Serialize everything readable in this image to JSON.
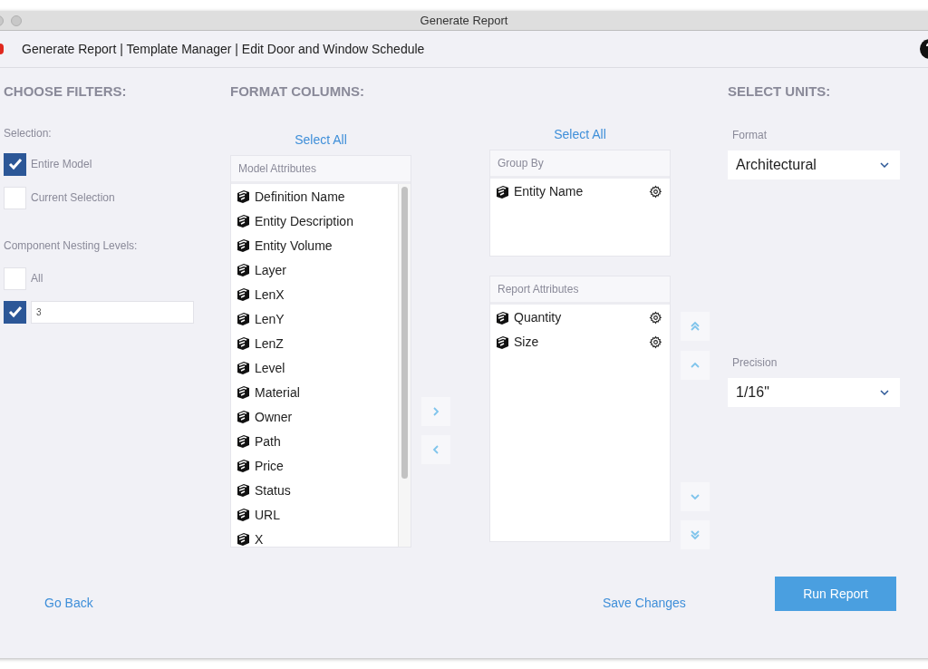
{
  "window": {
    "title": "Generate Report"
  },
  "breadcrumb": "Generate Report | Template Manager | Edit Door and Window Schedule",
  "filters": {
    "heading": "CHOOSE FILTERS:",
    "selection_label": "Selection:",
    "selection_options": [
      {
        "label": "Entire Model",
        "checked": true
      },
      {
        "label": "Current Selection",
        "checked": false
      }
    ],
    "nesting_label": "Component Nesting Levels:",
    "nesting_options": [
      {
        "kind": "checkbox",
        "label": "All",
        "checked": false
      },
      {
        "kind": "field",
        "value": "3",
        "checked": true
      }
    ]
  },
  "columns": {
    "heading": "FORMAT COLUMNS:",
    "model": {
      "select_all": "Select All",
      "title": "Model Attributes",
      "items": [
        "Definition Name",
        "Entity Description",
        "Entity Volume",
        "Layer",
        "LenX",
        "LenY",
        "LenZ",
        "Level",
        "Material",
        "Owner",
        "Path",
        "Price",
        "Status",
        "URL",
        "X"
      ]
    },
    "group_by": {
      "select_all": "Select All",
      "title": "Group By",
      "items": [
        "Entity Name"
      ]
    },
    "report": {
      "title": "Report Attributes",
      "items": [
        "Quantity",
        "Size"
      ]
    }
  },
  "units": {
    "heading": "SELECT UNITS:",
    "format": {
      "label": "Format",
      "value": "Architectural"
    },
    "precision": {
      "label": "Precision",
      "value": "1/16\""
    }
  },
  "footer": {
    "back": "Go Back",
    "save": "Save Changes",
    "run": "Run Report"
  }
}
